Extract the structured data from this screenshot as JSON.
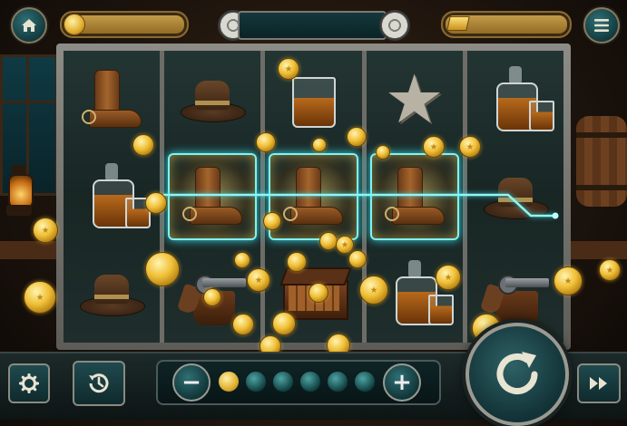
{
  "colors": {
    "accent_teal": "#123b40",
    "gold": "#e0ad2c",
    "win_glow": "#7ef4f2",
    "wood": "#3a2616"
  },
  "top_bar": {
    "home_icon": "home-icon",
    "coin_icon": "gold-coin-icon",
    "coins_value": "",
    "reel_icon": "film-reel-icon",
    "title_text": "",
    "gold_bar_icon": "gold-bar-icon",
    "gold_value": "",
    "menu_icon": "hamburger-menu-icon"
  },
  "reels": [
    [
      "boot",
      "whiskey-decanter",
      "cowboy-hat"
    ],
    [
      "cowboy-hat",
      "boot",
      "revolver-holster"
    ],
    [
      "whiskey-glass",
      "boot",
      "cigar-box"
    ],
    [
      "sheriff-badge",
      "boot",
      "whiskey-decanter"
    ],
    [
      "whiskey-decanter",
      "cowboy-hat",
      "revolver-holster"
    ]
  ],
  "winning_line": {
    "symbol": "boot",
    "row": 2,
    "reels": [
      2,
      3,
      4
    ]
  },
  "bottom_bar": {
    "settings_icon": "gear-icon",
    "history_icon": "history-clock-icon",
    "minus_label": "−",
    "plus_label": "+",
    "bet_level": 1,
    "bet_levels": 6,
    "spin_icon": "spin-arrow-icon",
    "fast_forward_icon": "fast-forward-icon"
  }
}
